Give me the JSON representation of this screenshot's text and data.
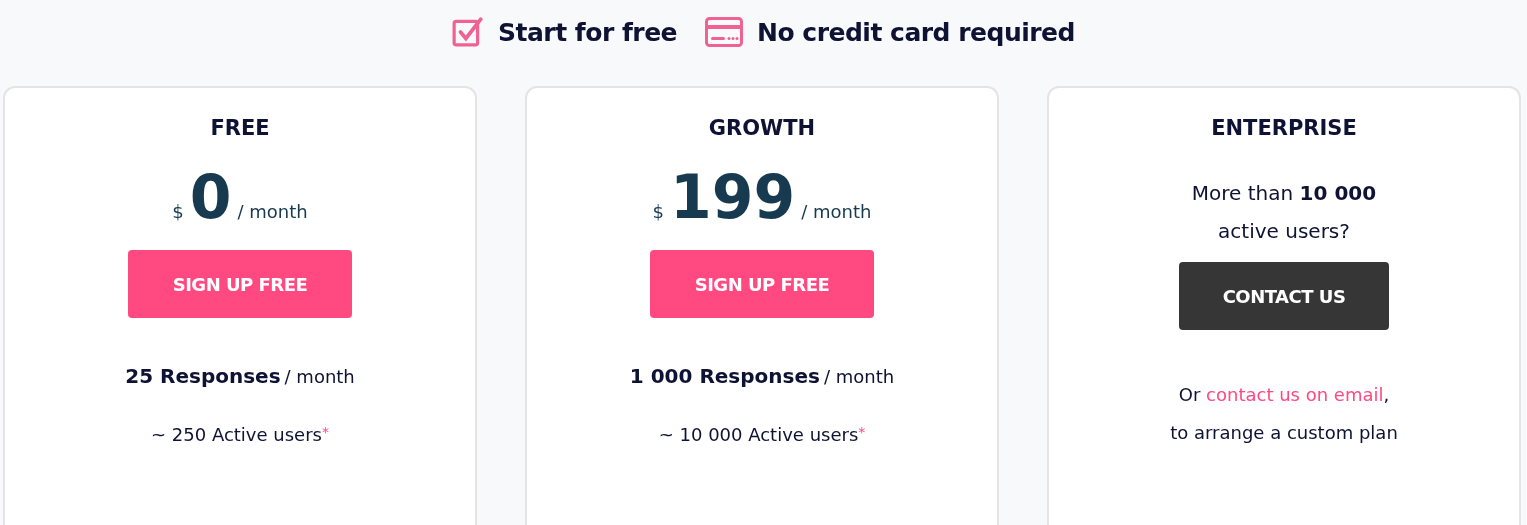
{
  "perks": [
    {
      "kind": "check",
      "label": "Start for free"
    },
    {
      "kind": "card",
      "label": "No credit card required"
    }
  ],
  "plans": [
    {
      "kind": "priced",
      "name": "FREE",
      "currency": "$",
      "amount": "0",
      "period": "/ month",
      "button": {
        "label": "SIGN UP FREE",
        "kind": "primary"
      },
      "responses": "25 Responses",
      "responses_period": "/ month",
      "users": "~ 250 Active users",
      "footnote": "*"
    },
    {
      "kind": "priced",
      "name": "GROWTH",
      "currency": "$",
      "amount": "199",
      "period": "/ month",
      "button": {
        "label": "SIGN UP FREE",
        "kind": "primary"
      },
      "responses": "1 000 Responses",
      "responses_period": "/ month",
      "users": "~ 10 000 Active users",
      "footnote": "*"
    },
    {
      "kind": "contact",
      "name": "ENTERPRISE",
      "question": "More than **10 000** active users?",
      "button": {
        "label": "CONTACT US",
        "kind": "dark"
      },
      "note_before": "Or",
      "link": "contact us on email",
      "note_after": ",",
      "note_line2": "to arrange a custom plan"
    }
  ]
}
